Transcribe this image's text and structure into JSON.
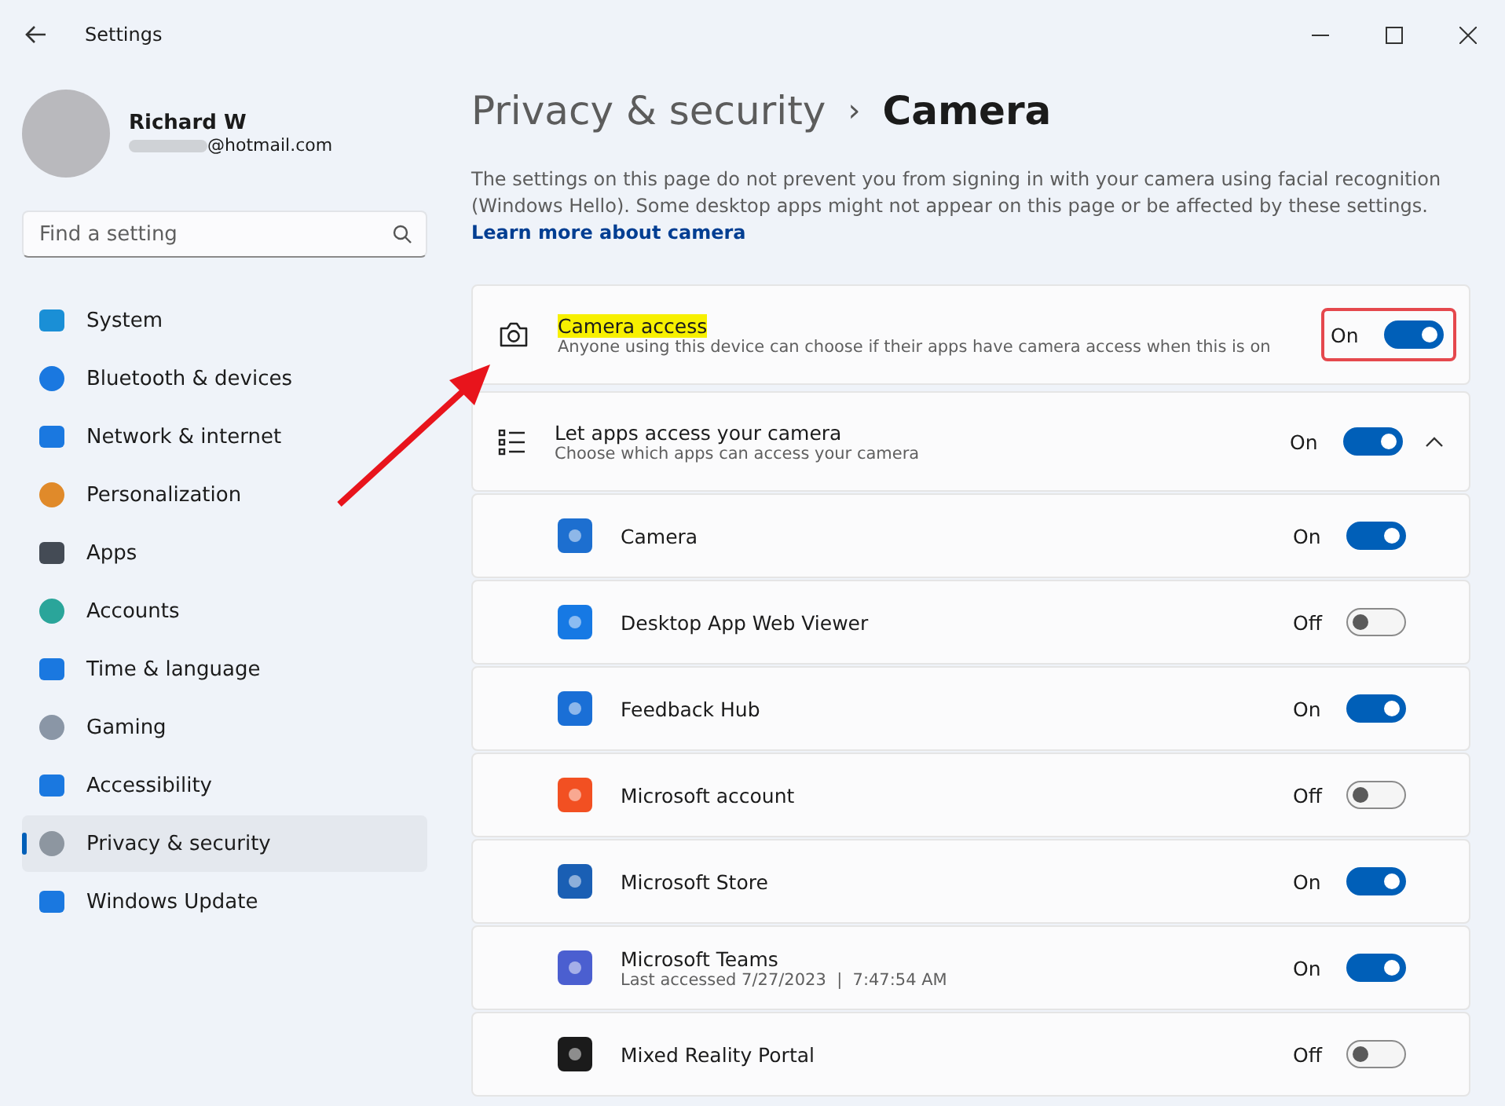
{
  "window": {
    "title": "Settings"
  },
  "user": {
    "name": "Richard W",
    "email": "@hotmail.com"
  },
  "search": {
    "placeholder": "Find a setting"
  },
  "sidebar": {
    "items": [
      {
        "label": "System",
        "selected": false
      },
      {
        "label": "Bluetooth & devices",
        "selected": false
      },
      {
        "label": "Network & internet",
        "selected": false
      },
      {
        "label": "Personalization",
        "selected": false
      },
      {
        "label": "Apps",
        "selected": false
      },
      {
        "label": "Accounts",
        "selected": false
      },
      {
        "label": "Time & language",
        "selected": false
      },
      {
        "label": "Gaming",
        "selected": false
      },
      {
        "label": "Accessibility",
        "selected": false
      },
      {
        "label": "Privacy & security",
        "selected": true
      },
      {
        "label": "Windows Update",
        "selected": false
      }
    ]
  },
  "breadcrumb": {
    "parent": "Privacy & security",
    "separator": "›",
    "current": "Camera"
  },
  "description": {
    "text": "The settings on this page do not prevent you from signing in with your camera using facial recognition (Windows Hello). Some desktop apps might not appear on this page or be affected by these settings.",
    "link": "Learn more about camera"
  },
  "camera_access": {
    "title": "Camera access",
    "subtitle": "Anyone using this device can choose if their apps have camera access when this is on",
    "state": "On",
    "on": true,
    "highlighted": true,
    "outlined": true
  },
  "apps_access": {
    "title": "Let apps access your camera",
    "subtitle": "Choose which apps can access your camera",
    "state": "On",
    "on": true,
    "expanded": true
  },
  "apps": [
    {
      "name": "Camera",
      "state": "On",
      "on": true
    },
    {
      "name": "Desktop App Web Viewer",
      "state": "Off",
      "on": false
    },
    {
      "name": "Feedback Hub",
      "state": "On",
      "on": true
    },
    {
      "name": "Microsoft account",
      "state": "Off",
      "on": false
    },
    {
      "name": "Microsoft Store",
      "state": "On",
      "on": true
    },
    {
      "name": "Microsoft Teams",
      "detail": "Last accessed 7/27/2023  |  7:47:54 AM",
      "state": "On",
      "on": true
    },
    {
      "name": "Mixed Reality Portal",
      "state": "Off",
      "on": false
    }
  ]
}
